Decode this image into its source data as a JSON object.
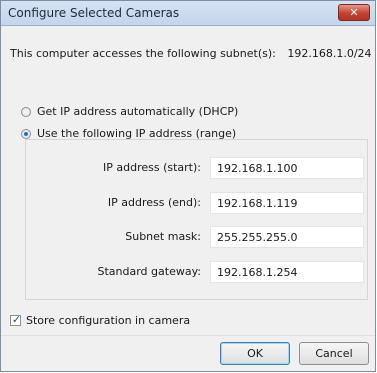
{
  "window": {
    "title": "Configure Selected Cameras",
    "close_glyph": "✕"
  },
  "subnet": {
    "label": "This computer accesses the following subnet(s):",
    "value": "192.168.1.0/24"
  },
  "ip_mode": {
    "dhcp_label": "Get IP address automatically (DHCP)",
    "dhcp_selected": false,
    "range_label": "Use the following IP address (range)",
    "range_selected": true
  },
  "fields": {
    "ip_start": {
      "label": "IP address (start):",
      "value": "192.168.1.100"
    },
    "ip_end": {
      "label": "IP address (end):",
      "value": "192.168.1.119"
    },
    "subnet_mask": {
      "label": "Subnet mask:",
      "value": "255.255.255.0"
    },
    "gateway": {
      "label": "Standard gateway:",
      "value": "192.168.1.254"
    }
  },
  "store_config": {
    "label": "Store configuration in camera",
    "checked": true,
    "check_glyph": "✓"
  },
  "buttons": {
    "ok": "OK",
    "cancel": "Cancel"
  },
  "colors": {
    "titlebar": "#c2d5ec",
    "close_button": "#c4422f",
    "radio_dot": "#1e6fc7",
    "dialog_bg": "#f0f0f0"
  }
}
